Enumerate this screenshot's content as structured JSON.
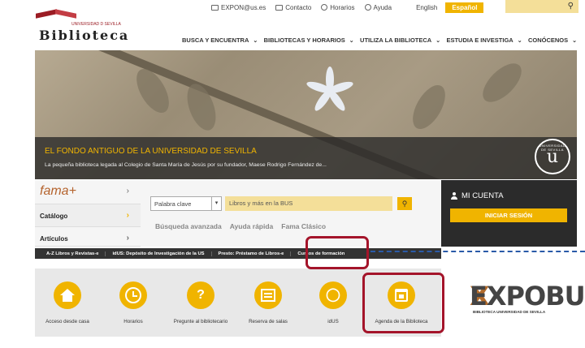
{
  "topbar": {
    "email": "EXPON@us.es",
    "contact": "Contacto",
    "hours": "Horarios",
    "help": "Ayuda",
    "lang_en": "English",
    "lang_es": "Español",
    "search_icon": "search-icon"
  },
  "logo": {
    "university": "UNIVERSIDAD D SEVILLA",
    "name": "Biblioteca"
  },
  "nav": [
    {
      "label": "BUSCA Y ENCUENTRA"
    },
    {
      "label": "BIBLIOTECAS Y HORARIOS"
    },
    {
      "label": "UTILIZA LA BIBLIOTECA"
    },
    {
      "label": "ESTUDIA E INVESTIGA"
    },
    {
      "label": "CONÓCENOS"
    }
  ],
  "hero": {
    "title": "EL FONDO ANTIGUO DE LA UNIVERSIDAD DE SEVILLA",
    "subtitle": "La pequeña biblioteca legada al Colegio de Santa María de Jesús por su fundador, Maese Rodrigo Fernández de...",
    "seal_text": "UNIVERSIDAD DE SEVILLA"
  },
  "catalog": {
    "fama_logo": "fama+",
    "items": [
      {
        "label": "Catálogo"
      },
      {
        "label": "Artículos"
      }
    ],
    "select_value": "Palabra clave",
    "query_placeholder": "Libros y más en la BUS",
    "links": [
      "Búsqueda avanzada",
      "Ayuda rápida",
      "Fama Clásico"
    ]
  },
  "account": {
    "title": "MI CUENTA",
    "login": "INICIAR SESIÓN"
  },
  "strip": [
    "A-Z Libros y Revistas-e",
    "idUS: Depósito de Investigación de la US",
    "Presto: Préstamo de Libros-e",
    "Cursos de formación"
  ],
  "services": [
    {
      "label": "Acceso desde casa",
      "icon": "home-icon"
    },
    {
      "label": "Horarios",
      "icon": "clock-icon"
    },
    {
      "label": "Pregunte al bibliotecario",
      "icon": "question-icon"
    },
    {
      "label": "Reserva de salas",
      "icon": "calendar-list-icon"
    },
    {
      "label": "idUS",
      "icon": "open-access-icon"
    },
    {
      "label": "Agenda de la Biblioteca",
      "icon": "calendar-icon"
    }
  ],
  "expobus": {
    "logo": "EXPOBUS",
    "subtitle": "BIBLIOTECA UNIVERSIDAD DE SEVILLA"
  },
  "colors": {
    "accent": "#f0b400",
    "highlight": "#a4142a",
    "dark": "#2b2b2b"
  }
}
